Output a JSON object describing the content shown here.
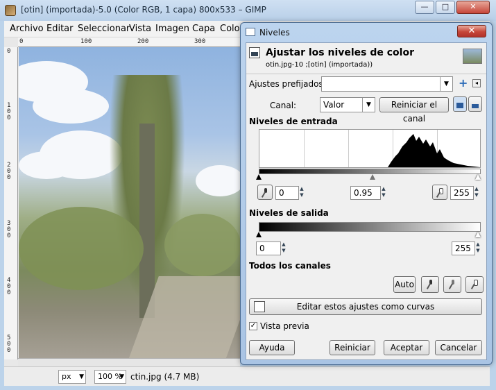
{
  "window": {
    "title": "[otin] (importada)-5.0 (Color RGB, 1 capa) 800x533 – GIMP",
    "buttons": {
      "minimize": "—",
      "maximize": "□",
      "close": "✕"
    }
  },
  "menubar": {
    "items": [
      "Archivo",
      "Editar",
      "Seleccionar",
      "Vista",
      "Imagen",
      "Capa",
      "Color"
    ]
  },
  "rulers": {
    "top": [
      "0",
      "100",
      "200",
      "300"
    ],
    "left": [
      "0",
      "100",
      "200",
      "300",
      "400",
      "500"
    ]
  },
  "statusbar": {
    "unit": "px",
    "zoom": "100 %",
    "file_info": "ctin.jpg (4.7 MB)"
  },
  "dialog": {
    "title": "Niveles",
    "close": "✕",
    "header_title": "Ajustar los niveles de color",
    "header_subtitle": "otin.jpg-10 ;[otin] (importada))",
    "presets_label": "Ajustes prefijados:",
    "presets_value": "",
    "channel_label": "Canal:",
    "channel_value": "Valor",
    "reset_channel": "Reiniciar el canal",
    "input_levels_label": "Niveles de entrada",
    "input_low": "0",
    "input_gamma": "0.95",
    "input_high": "255",
    "output_levels_label": "Niveles de salida",
    "output_low": "0",
    "output_high": "255",
    "all_channels_label": "Todos los canales",
    "auto_button": "Auto",
    "edit_as_curves": "Editar estos ajustes como curvas",
    "preview_label": "Vista previa",
    "preview_checked": true,
    "help_button": "Ayuda",
    "reset_button": "Reiniciar",
    "accept_button": "Aceptar",
    "cancel_button": "Cancelar"
  },
  "colors": {
    "title_bar": "#bcd4ee",
    "close_red": "#c6463a",
    "dialog_bg": "#f0f0f0"
  }
}
